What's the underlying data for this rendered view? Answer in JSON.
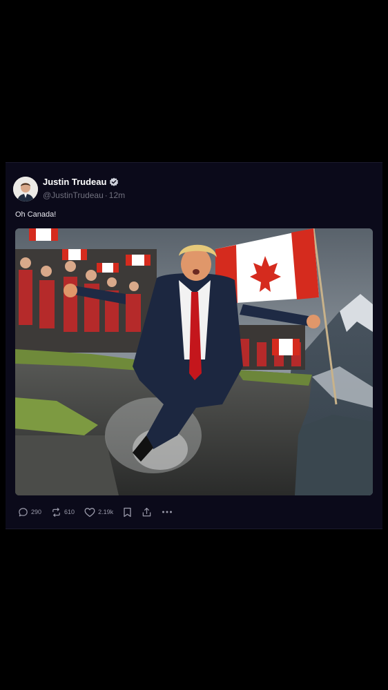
{
  "post": {
    "author": {
      "display_name": "Justin Trudeau",
      "handle": "@JustinTrudeau",
      "separator": "·",
      "time_ago": "12m",
      "verified": true
    },
    "text": "Oh Canada!",
    "media": {
      "type": "image"
    },
    "actions": {
      "replies": "290",
      "reposts": "610",
      "likes": "2.19k"
    }
  },
  "icons": {
    "reply": "reply-icon",
    "repost": "repost-icon",
    "like": "heart-icon",
    "bookmark": "bookmark-icon",
    "share": "share-icon",
    "more": "more-icon",
    "verified": "verified-badge-icon"
  },
  "colors": {
    "background": "#000000",
    "card": "#0b0a1a",
    "text": "#ffffff",
    "muted": "#71717f",
    "verified": "#cfd2dc",
    "flag_red": "#d52b1e"
  }
}
